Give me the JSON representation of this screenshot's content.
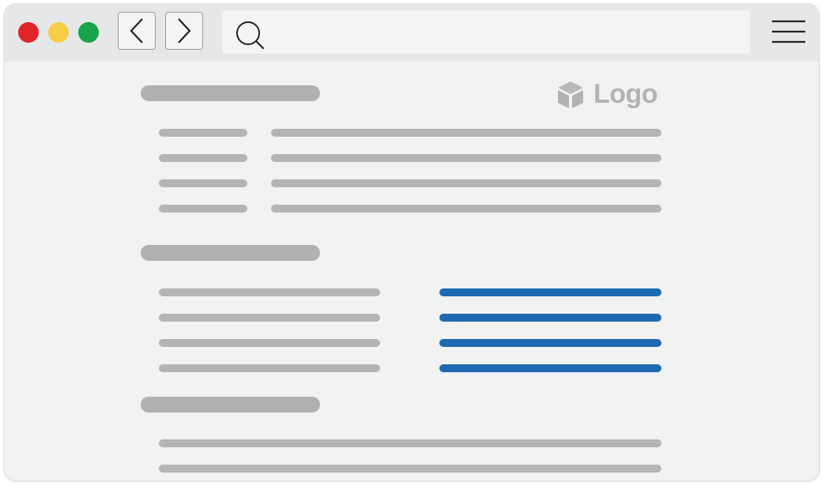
{
  "window": {
    "controls": [
      "close",
      "minimize",
      "maximize"
    ],
    "colors": {
      "close": "#e0242a",
      "minimize": "#f7cd46",
      "maximize": "#16a34a"
    }
  },
  "toolbar": {
    "back_icon": "chevron-left-icon",
    "forward_icon": "chevron-right-icon",
    "search_icon": "search-icon",
    "menu_icon": "hamburger-menu-icon"
  },
  "logo": {
    "icon": "cube-icon",
    "text": "Logo"
  },
  "accent_color": "#1d6ab2"
}
